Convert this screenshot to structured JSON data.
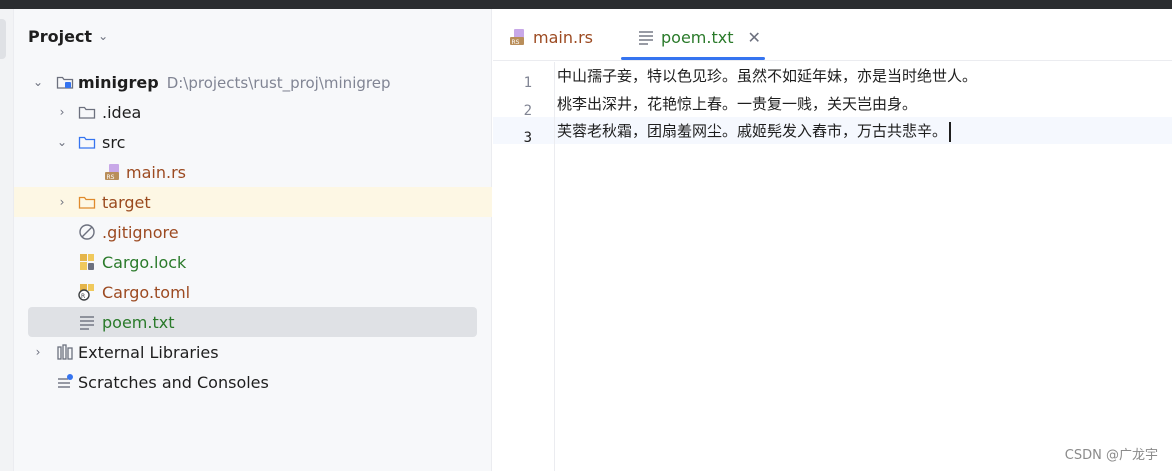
{
  "project_panel": {
    "title": "Project",
    "tree": {
      "root_name": "minigrep",
      "root_path": "D:\\projects\\rust_proj\\minigrep",
      "idea": ".idea",
      "src": "src",
      "main_rs": "main.rs",
      "target": "target",
      "gitignore": ".gitignore",
      "cargo_lock": "Cargo.lock",
      "cargo_toml": "Cargo.toml",
      "poem_txt": "poem.txt",
      "external_libraries": "External Libraries",
      "scratches": "Scratches and Consoles"
    }
  },
  "editor": {
    "tabs": [
      {
        "label": "main.rs",
        "icon": "rust-file-icon",
        "active": false
      },
      {
        "label": "poem.txt",
        "icon": "text-file-icon",
        "active": true
      }
    ],
    "lines": [
      {
        "number": "1",
        "text": "中山孺子妾，特以色见珍。虽然不如延年妹，亦是当时绝世人。"
      },
      {
        "number": "2",
        "text": "桃李出深井，花艳惊上春。一贵复一贱，关天岂由身。"
      },
      {
        "number": "3",
        "text": "芙蓉老秋霜，团扇羞网尘。戚姬髡发入舂市，万古共悲辛。"
      }
    ],
    "current_line": "3"
  },
  "watermark": "CSDN @广龙宇",
  "colors": {
    "accent": "#3574f0",
    "green_label": "#2a7a2a",
    "orange_label": "#9a4a1e",
    "hover_row": "#fdf7e4",
    "selected_row": "#dfe1e5"
  }
}
